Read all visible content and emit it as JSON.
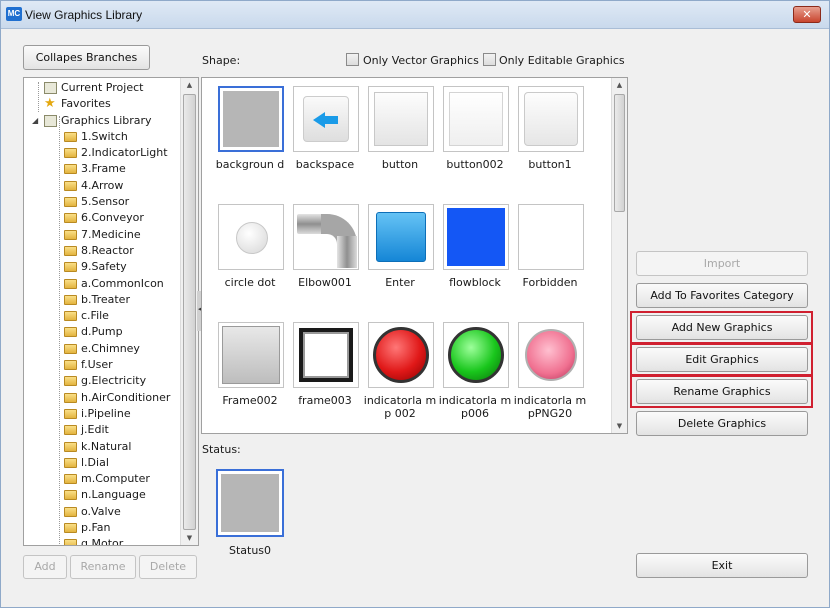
{
  "window": {
    "title": "View Graphics Library",
    "app_badge": "MC",
    "close_glyph": "✕"
  },
  "tree_panel": {
    "collapse_label": "Collapes Branches",
    "items": [
      {
        "label": "Current Project",
        "icon": "project-icon",
        "level": 1
      },
      {
        "label": "Favorites",
        "icon": "star-icon",
        "level": 1
      },
      {
        "label": "Graphics Library",
        "icon": "project-icon",
        "level": 1,
        "expanded": true
      },
      {
        "label": "1.Switch",
        "icon": "folder-icon",
        "level": 2
      },
      {
        "label": "2.IndicatorLight",
        "icon": "folder-icon",
        "level": 2
      },
      {
        "label": "3.Frame",
        "icon": "folder-icon",
        "level": 2
      },
      {
        "label": "4.Arrow",
        "icon": "folder-icon",
        "level": 2
      },
      {
        "label": "5.Sensor",
        "icon": "folder-icon",
        "level": 2
      },
      {
        "label": "6.Conveyor",
        "icon": "folder-icon",
        "level": 2
      },
      {
        "label": "7.Medicine",
        "icon": "folder-icon",
        "level": 2
      },
      {
        "label": "8.Reactor",
        "icon": "folder-icon",
        "level": 2
      },
      {
        "label": "9.Safety",
        "icon": "folder-icon",
        "level": 2
      },
      {
        "label": "a.CommonIcon",
        "icon": "folder-icon",
        "level": 2
      },
      {
        "label": "b.Treater",
        "icon": "folder-icon",
        "level": 2
      },
      {
        "label": "c.File",
        "icon": "folder-icon",
        "level": 2
      },
      {
        "label": "d.Pump",
        "icon": "folder-icon",
        "level": 2
      },
      {
        "label": "e.Chimney",
        "icon": "folder-icon",
        "level": 2
      },
      {
        "label": "f.User",
        "icon": "folder-icon",
        "level": 2
      },
      {
        "label": "g.Electricity",
        "icon": "folder-icon",
        "level": 2
      },
      {
        "label": "h.AirConditioner",
        "icon": "folder-icon",
        "level": 2
      },
      {
        "label": "i.Pipeline",
        "icon": "folder-icon",
        "level": 2
      },
      {
        "label": "j.Edit",
        "icon": "folder-icon",
        "level": 2
      },
      {
        "label": "k.Natural",
        "icon": "folder-icon",
        "level": 2
      },
      {
        "label": "l.Dial",
        "icon": "folder-icon",
        "level": 2
      },
      {
        "label": "m.Computer",
        "icon": "folder-icon",
        "level": 2
      },
      {
        "label": "n.Language",
        "icon": "folder-icon",
        "level": 2
      },
      {
        "label": "o.Valve",
        "icon": "folder-icon",
        "level": 2
      },
      {
        "label": "p.Fan",
        "icon": "folder-icon",
        "level": 2
      },
      {
        "label": "q.Motor",
        "icon": "folder-icon",
        "level": 2
      }
    ],
    "add_label": "Add",
    "rename_label": "Rename",
    "delete_label": "Delete"
  },
  "shape_panel": {
    "label": "Shape:",
    "only_vector_label": "Only Vector Graphics",
    "only_vector_checked": false,
    "only_editable_label": "Only Editable Graphics",
    "only_editable_checked": false,
    "items": [
      {
        "label": "backgroun d",
        "kind": "gray-fill",
        "selected": true
      },
      {
        "label": "backspace",
        "kind": "arrow-left"
      },
      {
        "label": "button",
        "kind": "plain-button"
      },
      {
        "label": "button002",
        "kind": "plain-button-light"
      },
      {
        "label": "button1",
        "kind": "plain-button-rounded"
      },
      {
        "label": "circle dot",
        "kind": "white-dot"
      },
      {
        "label": "Elbow001",
        "kind": "pipe-elbow"
      },
      {
        "label": "Enter",
        "kind": "blue-button"
      },
      {
        "label": "flowblock",
        "kind": "blue-block"
      },
      {
        "label": "Forbidden",
        "kind": "blank"
      },
      {
        "label": "Frame002",
        "kind": "gray-frame"
      },
      {
        "label": "frame003",
        "kind": "black-frame"
      },
      {
        "label": "indicatorla mp 002",
        "kind": "red-lamp"
      },
      {
        "label": "indicatorla mp006",
        "kind": "green-lamp"
      },
      {
        "label": "indicatorla mpPNG20",
        "kind": "pink-lamp"
      }
    ]
  },
  "status_panel": {
    "label": "Status:",
    "item_label": "Status0"
  },
  "actions": {
    "import_label": "Import",
    "add_favorites_label": "Add To Favorites Category",
    "add_new_label": "Add New Graphics",
    "edit_label": "Edit Graphics",
    "rename_label": "Rename Graphics",
    "delete_label": "Delete Graphics",
    "exit_label": "Exit"
  },
  "colors": {
    "highlight": "#d02030",
    "selection": "#3a6fd8",
    "lamp_red": "#e01818",
    "lamp_green": "#19c61c",
    "lamp_pink": "#f07090",
    "block_blue": "#1457f5"
  }
}
